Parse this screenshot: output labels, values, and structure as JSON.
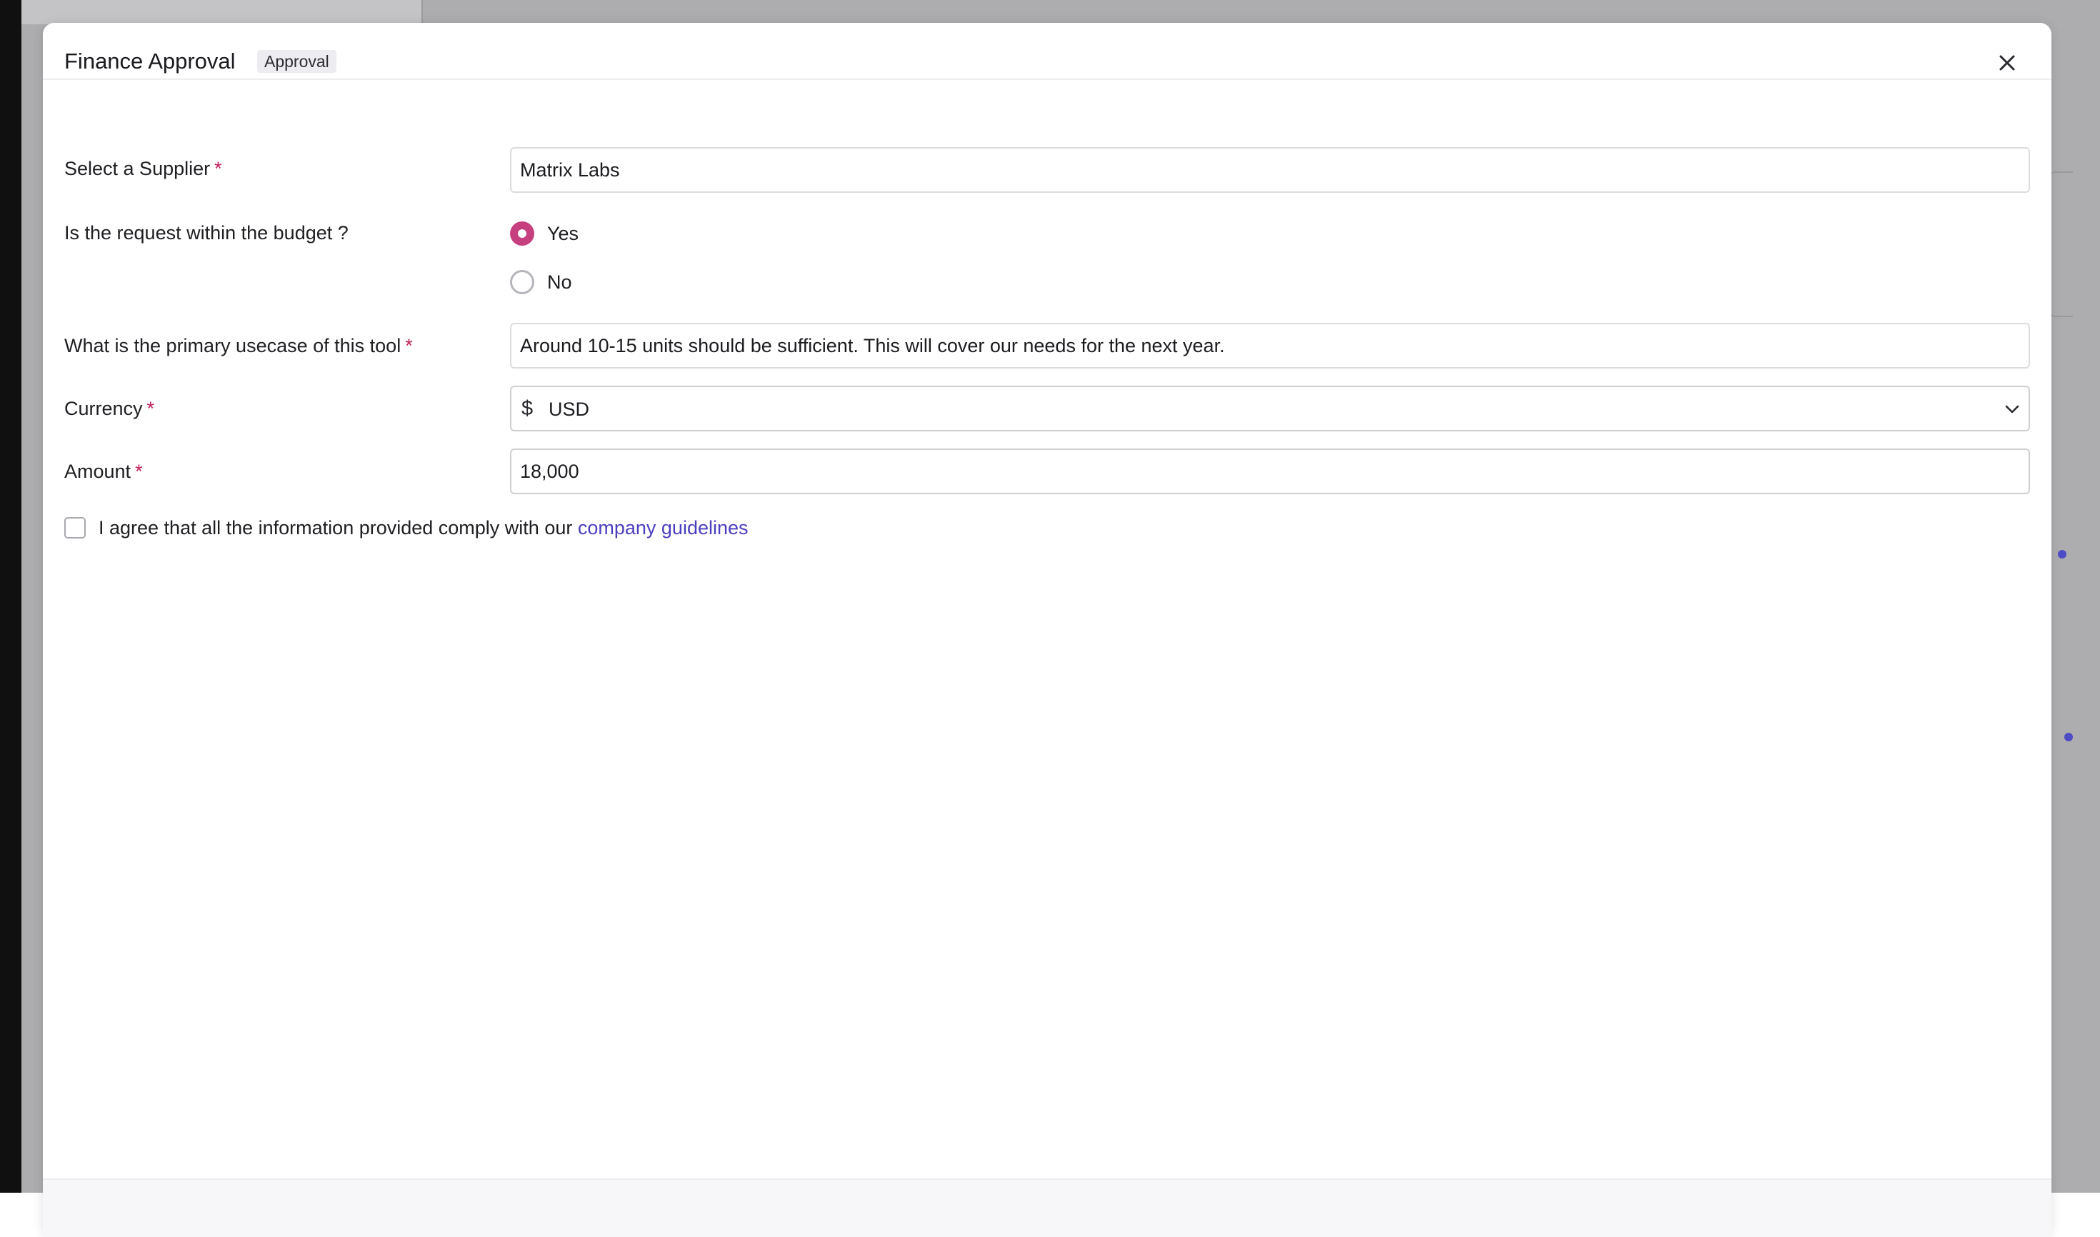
{
  "modal": {
    "title": "Finance Approval",
    "badge": "Approval"
  },
  "form": {
    "supplier": {
      "label": "Select a Supplier",
      "required_mark": "*",
      "value": "Matrix Labs"
    },
    "within_budget": {
      "label": "Is the request within the budget ?",
      "options": [
        {
          "label": "Yes",
          "checked": true
        },
        {
          "label": "No",
          "checked": false
        }
      ]
    },
    "usecase": {
      "label": "What is the primary usecase of this tool",
      "required_mark": "*",
      "value": "Around 10-15 units should be sufficient. This will cover our needs for the next year."
    },
    "currency": {
      "label": "Currency",
      "required_mark": "*",
      "symbol": "$",
      "value": "USD"
    },
    "amount": {
      "label": "Amount",
      "required_mark": "*",
      "value": "18,000"
    },
    "agreement": {
      "text": "I agree that all the information provided comply with our ",
      "link_text": "company guidelines",
      "checked": false
    }
  },
  "colors": {
    "accent_radio": "#c63f7f",
    "required": "#c21d5a",
    "link": "#4a3fc0",
    "backdrop": "#adadaf"
  }
}
